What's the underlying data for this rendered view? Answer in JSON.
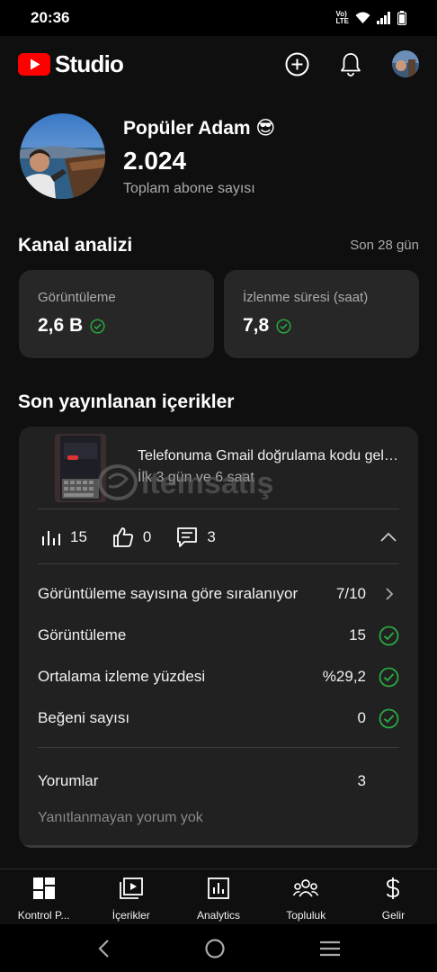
{
  "status_bar": {
    "time": "20:36",
    "volte_top": "Vo)",
    "volte_bottom": "LTE"
  },
  "header": {
    "logo_text": "Studio"
  },
  "channel": {
    "name": "Popüler Adam 😎",
    "subscriber_count": "2.024",
    "subscriber_label": "Toplam abone sayısı"
  },
  "analytics": {
    "title": "Kanal analizi",
    "period": "Son 28 gün",
    "cards": [
      {
        "label": "Görüntüleme",
        "value": "2,6 B"
      },
      {
        "label": "İzlenme süresi (saat)",
        "value": "7,8"
      }
    ]
  },
  "recent": {
    "title": "Son yayınlanan içerikler",
    "video": {
      "title": "Telefonuma Gmail doğrulama kodu gelmiyor",
      "age": "İlk 3 gün ve 6 saat",
      "views": "15",
      "likes": "0",
      "comments": "3"
    },
    "details": [
      {
        "label": "Görüntüleme sayısına göre sıralanıyor",
        "value": "7/10",
        "icon": "chevron-right-icon"
      },
      {
        "label": "Görüntüleme",
        "value": "15",
        "icon": "check-circle-icon"
      },
      {
        "label": "Ortalama izleme yüzdesi",
        "value": "%29,2",
        "icon": "check-circle-icon"
      },
      {
        "label": "Beğeni sayısı",
        "value": "0",
        "icon": "check-circle-icon"
      }
    ],
    "comments_label": "Yorumlar",
    "comments_value": "3",
    "no_reply": "Yanıtlanmayan yorum yok",
    "watermark": "itemsatış"
  },
  "bottom_nav": [
    {
      "label": "Kontrol P...",
      "icon": "dashboard-icon"
    },
    {
      "label": "İçerikler",
      "icon": "content-icon"
    },
    {
      "label": "Analytics",
      "icon": "analytics-icon"
    },
    {
      "label": "Topluluk",
      "icon": "community-icon"
    },
    {
      "label": "Gelir",
      "icon": "dollar-icon"
    }
  ],
  "colors": {
    "accent_green": "#2ba640",
    "youtube_red": "#ff0000",
    "card_bg": "#272727"
  }
}
